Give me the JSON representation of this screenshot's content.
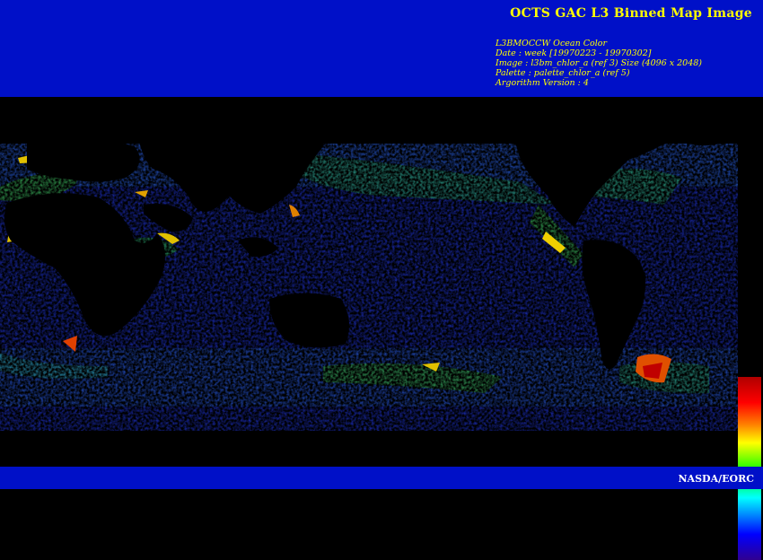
{
  "header": {
    "title": "OCTS GAC L3 Binned Map Image",
    "meta_lines": [
      "L3BMOCCW Ocean Color",
      "Date : week [19970223 - 19970302]",
      "Image : l3bm_chlor_a (ref 3) Size (4096 x 2048)",
      "Palette : palette_chlor_a (ref 5)",
      "Argorithm Version : 4"
    ]
  },
  "footer": {
    "credit": "NASDA/EORC"
  },
  "colors": {
    "banner": "#0010c8",
    "text": "#ffff00",
    "land": "#000000",
    "ocean_low": "#1a2cc8",
    "ocean_mid": "#3aa0e8",
    "ocean_high": "#40e040",
    "ocean_peak": "#ffd000",
    "ocean_extreme": "#e02000"
  },
  "icons": {
    "colorbar": "chlorophyll-palette-colorbar"
  }
}
